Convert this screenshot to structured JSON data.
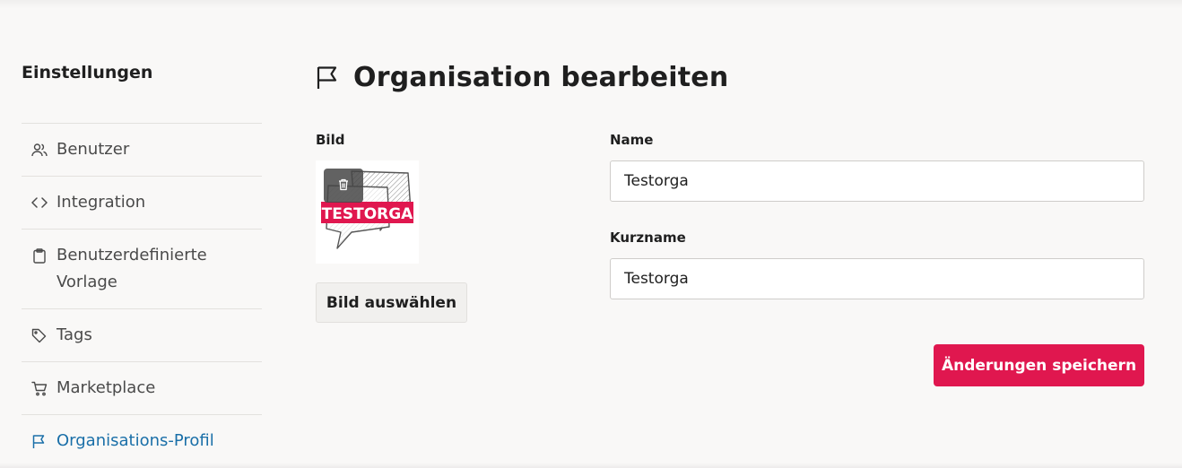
{
  "sidebar": {
    "title": "Einstellungen",
    "items": [
      {
        "label": "Benutzer",
        "icon": "users-icon"
      },
      {
        "label": "Integration",
        "icon": "code-icon"
      },
      {
        "label": "Benutzerdefinierte Vorlage",
        "icon": "clipboard-icon"
      },
      {
        "label": "Tags",
        "icon": "tag-icon"
      },
      {
        "label": "Marketplace",
        "icon": "cart-icon"
      },
      {
        "label": "Organisations-Profil",
        "icon": "flag-icon",
        "active": true
      }
    ]
  },
  "main": {
    "title": "Organisation bearbeiten",
    "title_icon": "flag-icon",
    "image": {
      "label": "Bild",
      "logo_text": "TESTORGA",
      "choose_label": "Bild auswählen"
    },
    "name": {
      "label": "Name",
      "value": "Testorga"
    },
    "short_name": {
      "label": "Kurzname",
      "value": "Testorga"
    },
    "save_label": "Änderungen speichern"
  },
  "colors": {
    "accent": "#e0174f",
    "active_link": "#1a6fa8",
    "background": "#f9f8f7"
  }
}
